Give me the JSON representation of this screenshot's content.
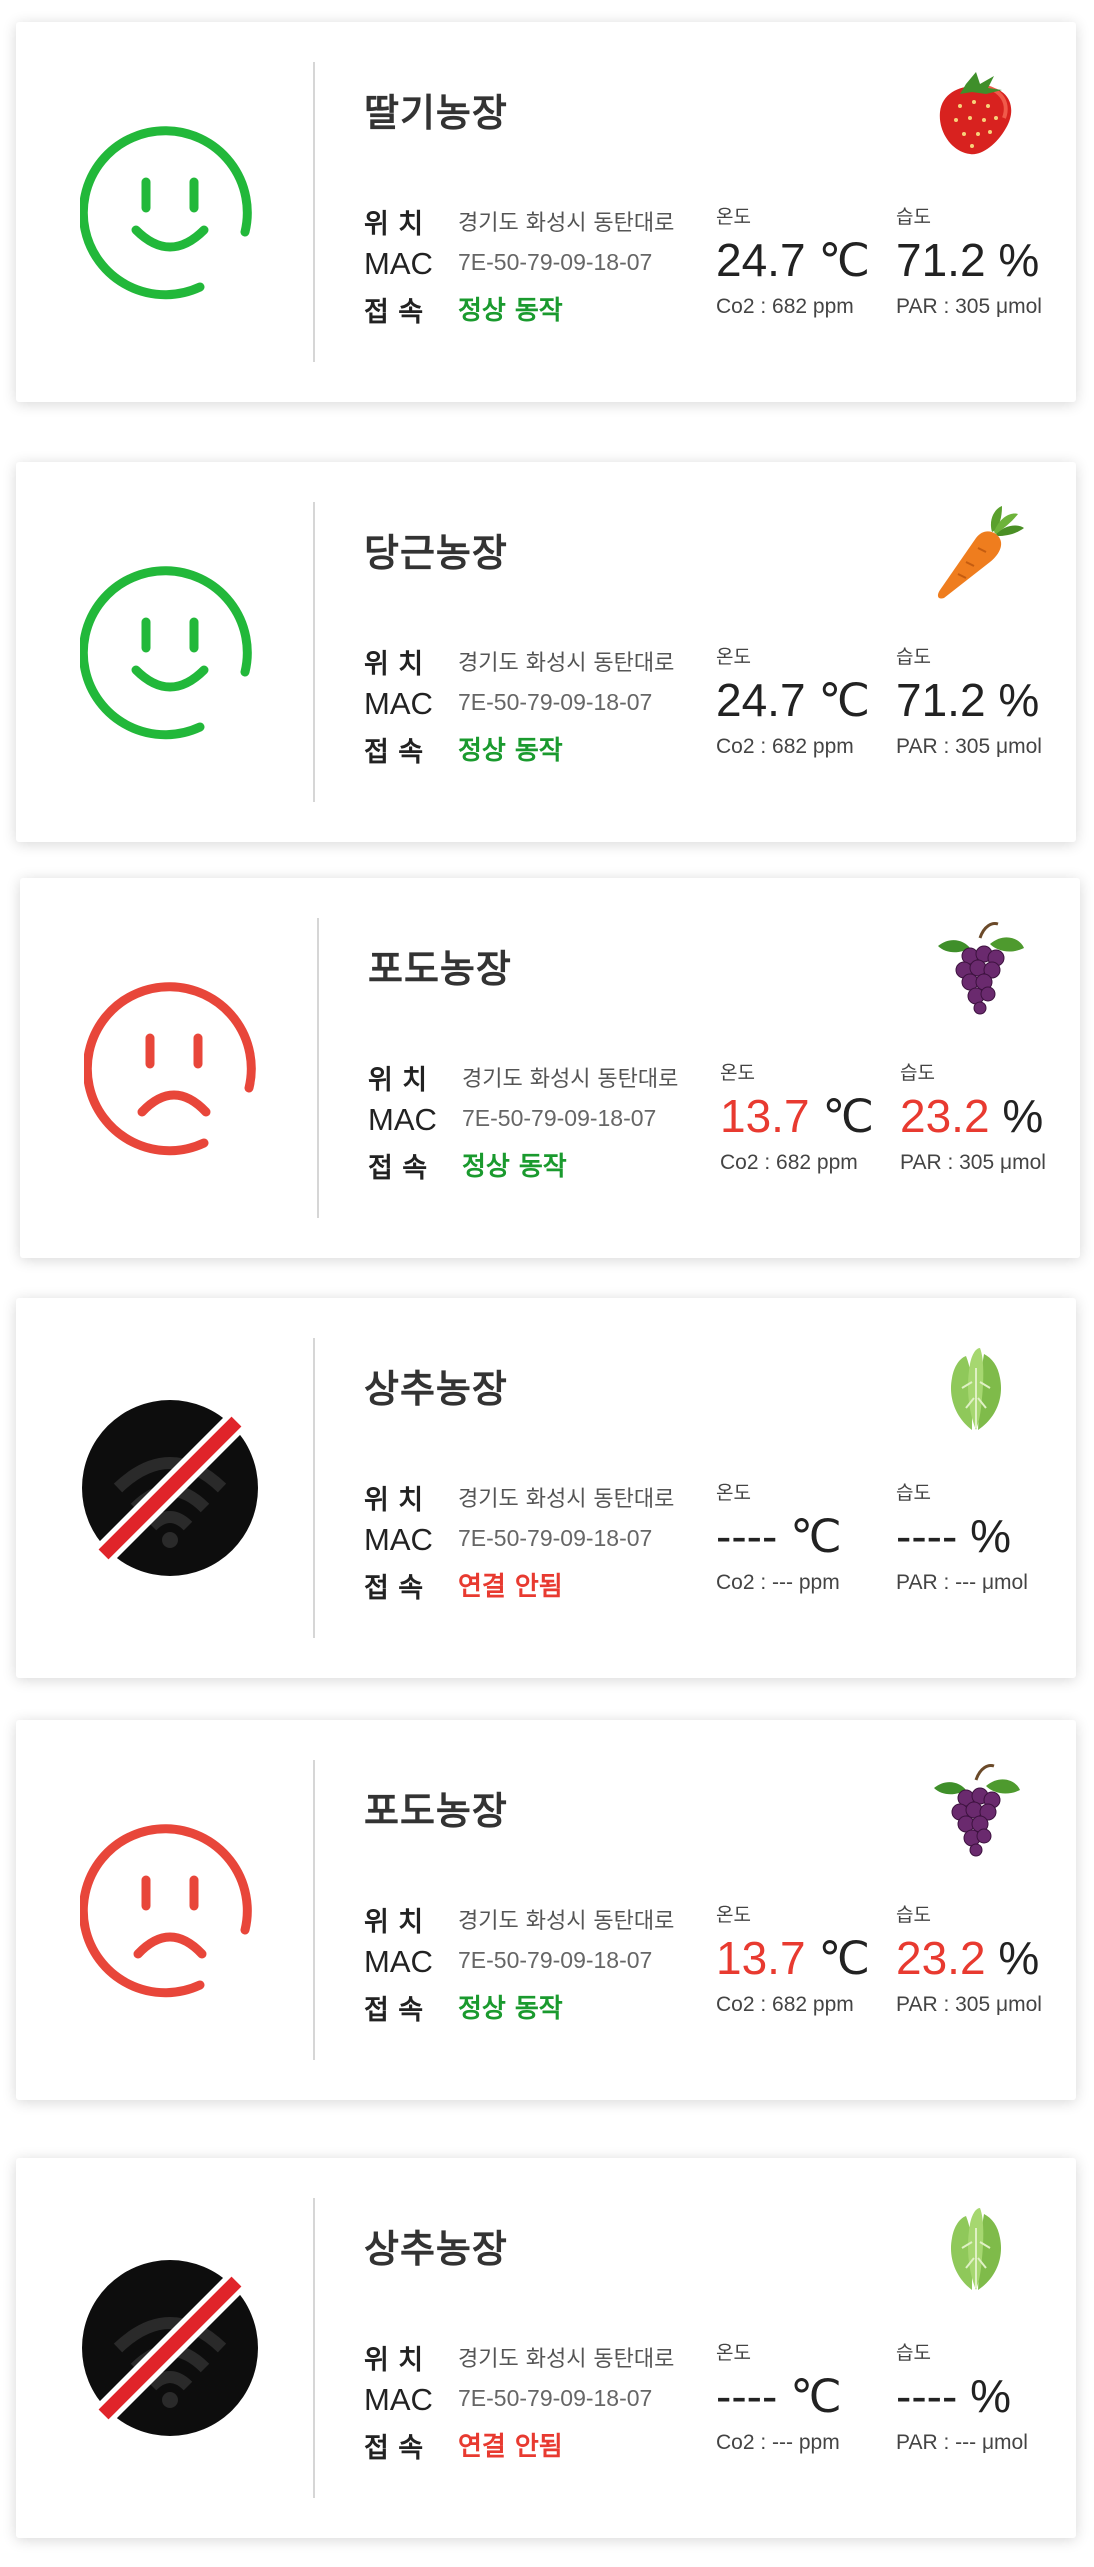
{
  "cards": [
    {
      "face": "happy",
      "crop": "strawberry",
      "name": "딸기농장",
      "loc_label": "위 치",
      "loc": "경기도 화성시 동탄대로",
      "mac_label": "MAC",
      "mac": "7E-50-79-09-18-07",
      "conn_label": "접 속",
      "conn": "정상 동작",
      "conn_state": "ok",
      "temp_label": "온도",
      "temp": "24.7",
      "temp_unit": "℃",
      "temp_alert": false,
      "hum_label": "습도",
      "hum": "71.2",
      "hum_unit": "%",
      "hum_alert": false,
      "co2": "Co2 : 682 ppm",
      "par": "PAR : 305 μmol"
    },
    {
      "face": "happy",
      "crop": "carrot",
      "name": "당근농장",
      "loc_label": "위 치",
      "loc": "경기도 화성시 동탄대로",
      "mac_label": "MAC",
      "mac": "7E-50-79-09-18-07",
      "conn_label": "접 속",
      "conn": "정상 동작",
      "conn_state": "ok",
      "temp_label": "온도",
      "temp": "24.7",
      "temp_unit": "℃",
      "temp_alert": false,
      "hum_label": "습도",
      "hum": "71.2",
      "hum_unit": "%",
      "hum_alert": false,
      "co2": "Co2 : 682 ppm",
      "par": "PAR : 305 μmol"
    },
    {
      "face": "sad",
      "crop": "grape",
      "name": "포도농장",
      "loc_label": "위 치",
      "loc": "경기도 화성시 동탄대로",
      "mac_label": "MAC",
      "mac": "7E-50-79-09-18-07",
      "conn_label": "접 속",
      "conn": "정상 동작",
      "conn_state": "ok",
      "temp_label": "온도",
      "temp": "13.7",
      "temp_unit": "℃",
      "temp_alert": true,
      "hum_label": "습도",
      "hum": "23.2",
      "hum_unit": "%",
      "hum_alert": true,
      "co2": "Co2 : 682 ppm",
      "par": "PAR : 305 μmol"
    },
    {
      "face": "offline",
      "crop": "lettuce",
      "name": "상추농장",
      "loc_label": "위 치",
      "loc": "경기도 화성시 동탄대로",
      "mac_label": "MAC",
      "mac": "7E-50-79-09-18-07",
      "conn_label": "접 속",
      "conn": "연결 안됨",
      "conn_state": "bad",
      "temp_label": "온도",
      "temp": "----",
      "temp_unit": "℃",
      "temp_alert": false,
      "hum_label": "습도",
      "hum": "----",
      "hum_unit": "%",
      "hum_alert": false,
      "co2": "Co2 : --- ppm",
      "par": "PAR : --- μmol"
    },
    {
      "face": "sad",
      "crop": "grape",
      "name": "포도농장",
      "loc_label": "위 치",
      "loc": "경기도 화성시 동탄대로",
      "mac_label": "MAC",
      "mac": "7E-50-79-09-18-07",
      "conn_label": "접 속",
      "conn": "정상 동작",
      "conn_state": "ok",
      "temp_label": "온도",
      "temp": "13.7",
      "temp_unit": "℃",
      "temp_alert": true,
      "hum_label": "습도",
      "hum": "23.2",
      "hum_unit": "%",
      "hum_alert": true,
      "co2": "Co2 : 682 ppm",
      "par": "PAR : 305 μmol"
    },
    {
      "face": "offline",
      "crop": "lettuce",
      "name": "상추농장",
      "loc_label": "위 치",
      "loc": "경기도 화성시 동탄대로",
      "mac_label": "MAC",
      "mac": "7E-50-79-09-18-07",
      "conn_label": "접 속",
      "conn": "연결 안됨",
      "conn_state": "bad",
      "temp_label": "온도",
      "temp": "----",
      "temp_unit": "℃",
      "temp_alert": false,
      "hum_label": "습도",
      "hum": "----",
      "hum_unit": "%",
      "hum_alert": false,
      "co2": "Co2 : --- ppm",
      "par": "PAR : --- μmol"
    }
  ],
  "colors": {
    "ok": "#1a9a2e",
    "alert": "#e83a30",
    "happy": "#22b83a",
    "sad": "#e8463a"
  }
}
